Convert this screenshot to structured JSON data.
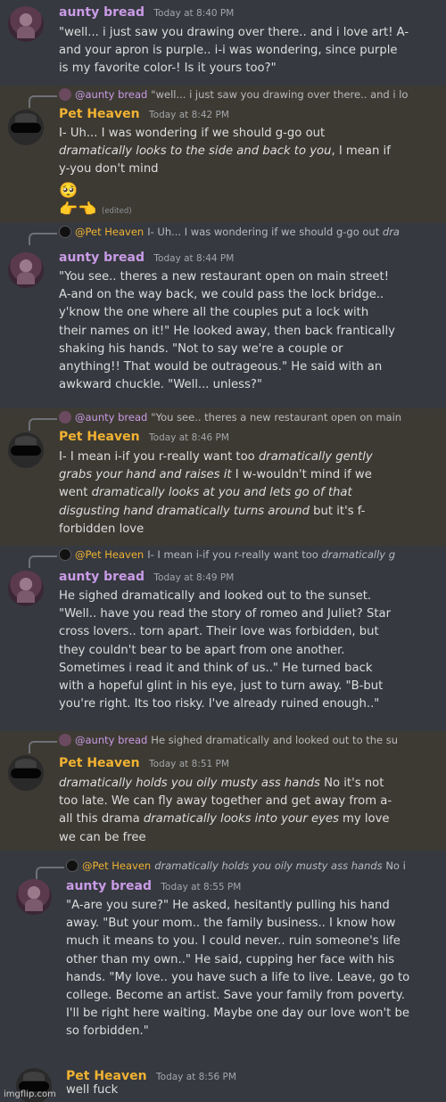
{
  "messages": [
    {
      "author": "aunty bread",
      "timestamp": "Today at 8:40 PM",
      "lines": [
        "\"well... i just saw you drawing over there.. and i love art! A-",
        "and your apron is purple.. i-i was wondering, since purple",
        "is my favorite color-! Is it yours too?\""
      ]
    },
    {
      "reply_author": "@aunty bread",
      "reply_text": "\"well... i just saw you drawing over there.. and i lo",
      "author": "Pet Heaven",
      "timestamp": "Today at 8:42 PM",
      "lines": [
        "I- Uh... I was wondering if we should g-go out",
        "|| I mean if",
        "y-you don't mind"
      ],
      "italic": "dramatically looks to the side and back to you",
      "emoji1": "🥺",
      "emoji2": "👉👈",
      "edited": "(edited)"
    },
    {
      "reply_author": "@Pet Heaven",
      "reply_text": "I- Uh... I was wondering if we should g-go out",
      "reply_italic": "dra",
      "author": "aunty bread",
      "timestamp": "Today at 8:44 PM",
      "lines": [
        "\"You see.. theres a new restaurant open on main street!",
        "A-and on the way back, we could pass the lock bridge..",
        "y'know the one where all the couples put a lock with",
        "their names on it!\" He looked away, then back frantically",
        "shaking his hands. \"Not to say we're a couple or",
        "anything!! That would be outrageous.\" He said with an",
        "awkward chuckle. \"Well... unless?\""
      ]
    },
    {
      "reply_author": "@aunty bread",
      "reply_text": "\"You see.. theres a new restaurant open on main",
      "author": "Pet Heaven",
      "timestamp": "Today at 8:46 PM",
      "l1a": "I- I mean i-if you r-really want too ",
      "l1i": "dramatically gently",
      "l2i": "grabs your hand and raises it",
      "l2b": " I w-wouldn't mind if we",
      "l3a": "went ",
      "l3i": "dramatically looks at you and lets go of that",
      "l4i": "disgusting hand dramatically turns around",
      "l4b": " but it's f-",
      "l5a": "forbidden love"
    },
    {
      "reply_author": "@Pet Heaven",
      "reply_text": "I- I mean i-if you r-really want too",
      "reply_italic": "dramatically g",
      "author": "aunty bread",
      "timestamp": "Today at 8:49 PM",
      "lines": [
        "He sighed dramatically and looked out to the sunset.",
        "\"Well.. have you read the story of romeo and Juliet? Star",
        "cross lovers.. torn apart. Their love was forbidden, but",
        "they couldn't bear to be apart from one another.",
        "Sometimes i read it and think of us..\" He turned back",
        "with a hopeful glint in his eye, just to turn away. \"B-but",
        "you're right. Its too risky. I've already ruined enough..\""
      ]
    },
    {
      "reply_author": "@aunty bread",
      "reply_text": "He sighed dramatically and looked out to the su",
      "author": "Pet Heaven",
      "timestamp": "Today at 8:51 PM",
      "l1i": "dramatically holds you oily musty ass hands",
      "l1b": " No it's not",
      "l2a": "too late. We can fly away together and get away from a-",
      "l3a": "all this drama ",
      "l3i": "dramatically looks into your eyes",
      "l3b": " my love",
      "l4a": "we can be free"
    },
    {
      "reply_author": "@Pet Heaven",
      "reply_italic": "dramatically holds you oily musty ass hands",
      "reply_text": "No i",
      "author": "aunty bread",
      "timestamp": "Today at 8:55 PM",
      "lines": [
        "\"A-are you sure?\" He asked, hesitantly pulling his hand",
        "away. \"But your mom.. the family business.. I know how",
        "much it means to you. I could never.. ruin someone's life",
        "other than my own..\" He said, cupping her face with his",
        "hands. \"My love.. you have such a life to live. Leave, go to",
        "college. Become an artist. Save your family from poverty.",
        "I'll be right here waiting. Maybe one day our love won't be",
        "so forbidden.\""
      ]
    },
    {
      "author": "Pet Heaven",
      "timestamp": "Today at 8:56 PM",
      "lines": [
        "well fuck"
      ]
    }
  ],
  "watermark": "imgflip.com",
  "colors": {
    "background": "#36393f",
    "highlight": "#3d3a33",
    "bread_name": "#c99be6",
    "pet_name": "#f0b232"
  }
}
